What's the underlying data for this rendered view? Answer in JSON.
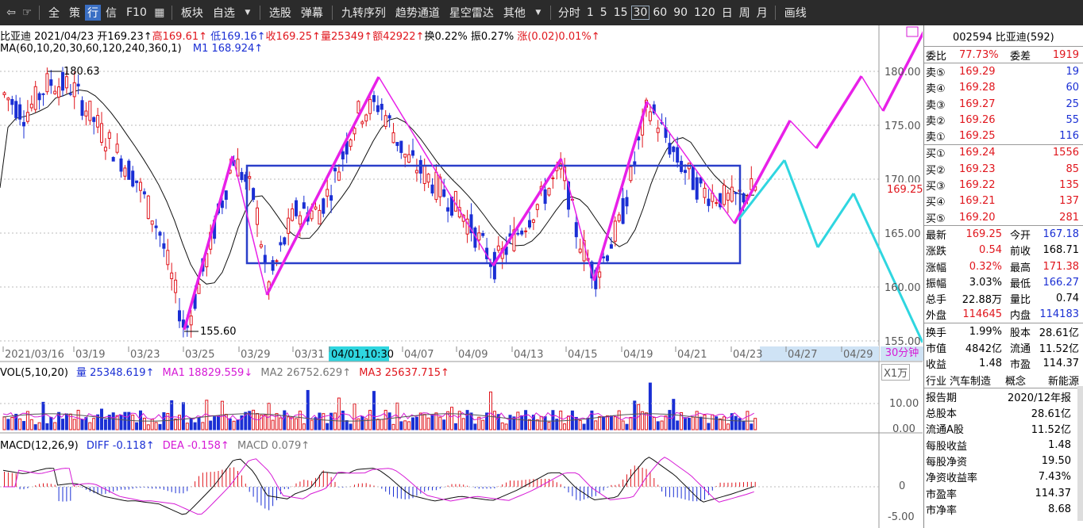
{
  "toolbar": {
    "nav": [
      "⇦",
      "☞"
    ],
    "items": [
      "全",
      "策",
      "行",
      "信",
      "F10"
    ],
    "active": "行",
    "group2": [
      "板块",
      "自选"
    ],
    "group3": [
      "选股",
      "弹幕"
    ],
    "group4": [
      "九转序列",
      "趋势通道",
      "星空雷达",
      "其他"
    ],
    "periods": [
      "分时",
      "1",
      "5",
      "15",
      "30",
      "60",
      "90",
      "120",
      "日",
      "周",
      "月"
    ],
    "selected_period": "30",
    "draw": "画线"
  },
  "header": {
    "name": "比亚迪",
    "date": "2021/04/23",
    "open": "开169.23↑",
    "high": "高169.61↑",
    "low": "低169.16↑",
    "close": "收169.25↑",
    "volume": "量25349↑",
    "amount": "额42922↑",
    "turnover": "换0.22%",
    "amplitude": "振0.27%",
    "change": "涨(0.02)0.01%↑",
    "ma_params": "MA(60,10,20,30,60,120,240,360,1)",
    "ma1": "M1 168.924↑"
  },
  "price_axis": [
    "180.00",
    "175.00",
    "170.00",
    "165.00",
    "160.00",
    "155.00"
  ],
  "current_price": "169.25",
  "annotations": {
    "high": "180.63",
    "low": "155.60"
  },
  "date_axis": [
    "2021/03/16",
    "03/19",
    "03/23",
    "03/25",
    "03/29",
    "03/31",
    "04/01,10:30",
    "04/07",
    "04/09",
    "04/13",
    "04/15",
    "04/19",
    "04/21",
    "04/23",
    "04/27",
    "04/29"
  ],
  "period_label": "30分钟",
  "vol": {
    "params": "VOL(5,10,20)",
    "value": "量 25348.619↑",
    "ma1": "MA1 18829.559↓",
    "ma2": "MA2 26752.629↑",
    "ma3": "MA3 25637.715↑",
    "unit": "X1万",
    "axis": [
      "10.00",
      "0.00"
    ]
  },
  "macd": {
    "params": "MACD(12,26,9)",
    "diff": "DIFF -0.118↑",
    "dea": "DEA -0.158↑",
    "macd": "MACD 0.079↑",
    "axis": [
      "0",
      "-5.00"
    ]
  },
  "colors": {
    "up": "#e0161d",
    "down": "#1a2fd4",
    "pattern": "#e820e8",
    "forecast": "#2fd6e0",
    "box": "#2a3fc9"
  },
  "right_panel": {
    "code": "002594 比亚迪(592)",
    "ratio": {
      "label": "委比",
      "value": "77.73%",
      "label2": "委差",
      "value2": "1919"
    },
    "asks": [
      {
        "label": "卖⑤",
        "price": "169.29",
        "vol": "19"
      },
      {
        "label": "卖④",
        "price": "169.28",
        "vol": "60"
      },
      {
        "label": "卖③",
        "price": "169.27",
        "vol": "25"
      },
      {
        "label": "卖②",
        "price": "169.26",
        "vol": "55"
      },
      {
        "label": "卖①",
        "price": "169.25",
        "vol": "116"
      }
    ],
    "bids": [
      {
        "label": "买①",
        "price": "169.24",
        "vol": "1556"
      },
      {
        "label": "买②",
        "price": "169.23",
        "vol": "85"
      },
      {
        "label": "买③",
        "price": "169.22",
        "vol": "135"
      },
      {
        "label": "买④",
        "price": "169.21",
        "vol": "137"
      },
      {
        "label": "买⑤",
        "price": "169.20",
        "vol": "281"
      }
    ],
    "quote": [
      {
        "l1": "最新",
        "v1": "169.25",
        "l2": "今开",
        "v2": "167.18"
      },
      {
        "l1": "涨跌",
        "v1": "0.54",
        "l2": "前收",
        "v2": "168.71"
      },
      {
        "l1": "涨幅",
        "v1": "0.32%",
        "l2": "最高",
        "v2": "171.38"
      },
      {
        "l1": "振幅",
        "v1": "3.03%",
        "l2": "最低",
        "v2": "166.27"
      },
      {
        "l1": "总手",
        "v1": "22.88万",
        "l2": "量比",
        "v2": "0.74"
      },
      {
        "l1": "外盘",
        "v1": "114645",
        "l2": "内盘",
        "v2": "114183"
      }
    ],
    "stats": [
      {
        "l1": "换手",
        "v1": "1.99%",
        "l2": "股本",
        "v2": "28.61亿"
      },
      {
        "l1": "市值",
        "v1": "4842亿",
        "l2": "流通",
        "v2": "11.52亿"
      },
      {
        "l1": "收益",
        "v1": "1.48",
        "l2": "市盈",
        "v2": "114.37"
      }
    ],
    "industry": {
      "l1": "行业",
      "v1": "汽车制造",
      "l2": "概念",
      "v2": "新能源"
    },
    "finance": [
      {
        "label": "报告期",
        "value": "2020/12年报"
      },
      {
        "label": "总股本",
        "value": "28.61亿"
      },
      {
        "label": "流通A股",
        "value": "11.52亿"
      },
      {
        "label": "每股收益",
        "value": "1.48"
      },
      {
        "label": "每股净资",
        "value": "19.50"
      },
      {
        "label": "净资收益率",
        "value": "7.43%"
      },
      {
        "label": "市盈率",
        "value": "114.37"
      },
      {
        "label": "市净率",
        "value": "8.68"
      }
    ]
  }
}
